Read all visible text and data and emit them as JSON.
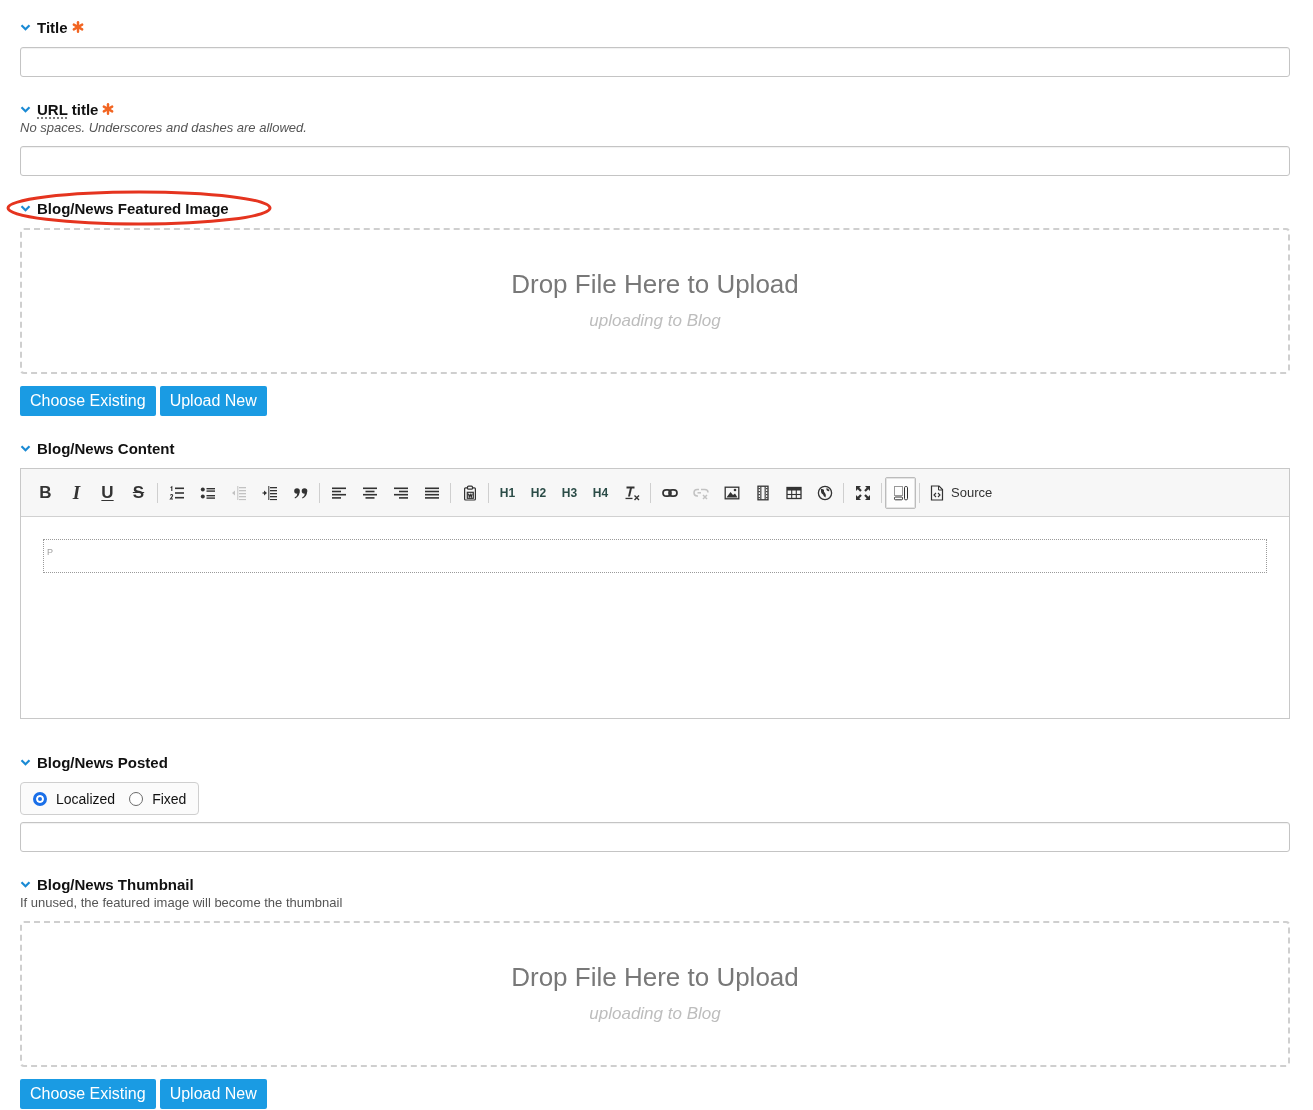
{
  "fields": [
    {
      "kind": "text",
      "label": "Title",
      "required": true,
      "expanded": true,
      "circled": false
    },
    {
      "kind": "text",
      "abbr": "URL",
      "label": "title",
      "required": true,
      "expanded": true,
      "circled": false,
      "hint": "No spaces. Underscores and dashes are allowed.",
      "hint_italic": true
    },
    {
      "kind": "file",
      "label": "Blog/News Featured Image",
      "required": false,
      "expanded": true,
      "circled": true,
      "dropzone": {
        "title": "Drop File Here to Upload",
        "subtitle": "uploading to Blog"
      },
      "buttons": [
        "Choose Existing",
        "Upload New"
      ]
    },
    {
      "kind": "editor",
      "label": "Blog/News Content",
      "required": false,
      "expanded": true,
      "circled": false,
      "toolbar": [
        [
          {
            "kind": "bold",
            "label": "B",
            "disabled": false,
            "on": false
          },
          {
            "kind": "italic",
            "label": "I",
            "disabled": false,
            "on": false
          },
          {
            "kind": "underline",
            "label": "U",
            "disabled": false,
            "on": false
          },
          {
            "kind": "strike",
            "label": "S",
            "disabled": false,
            "on": false
          }
        ],
        [
          {
            "kind": "ordered",
            "disabled": false,
            "on": false
          },
          {
            "kind": "bullets",
            "disabled": false,
            "on": false
          },
          {
            "kind": "outdent",
            "disabled": true,
            "on": false
          },
          {
            "kind": "indent",
            "disabled": false,
            "on": false
          },
          {
            "kind": "quote",
            "disabled": false,
            "on": false
          }
        ],
        [
          {
            "kind": "alignleft",
            "disabled": false,
            "on": false
          },
          {
            "kind": "aligncenter",
            "disabled": false,
            "on": false
          },
          {
            "kind": "alignright",
            "disabled": false,
            "on": false
          },
          {
            "kind": "justify",
            "disabled": false,
            "on": false
          }
        ],
        [
          {
            "kind": "pasteword",
            "disabled": false,
            "on": false
          }
        ],
        [
          {
            "kind": "heading",
            "label": "H1",
            "disabled": false,
            "on": false
          },
          {
            "kind": "heading",
            "label": "H2",
            "disabled": false,
            "on": false
          },
          {
            "kind": "heading",
            "label": "H3",
            "disabled": false,
            "on": false
          },
          {
            "kind": "heading",
            "label": "H4",
            "disabled": false,
            "on": false
          },
          {
            "kind": "clearformat",
            "disabled": false,
            "on": false
          }
        ],
        [
          {
            "kind": "link",
            "disabled": false,
            "on": false
          },
          {
            "kind": "unlink",
            "disabled": true,
            "on": false
          },
          {
            "kind": "image",
            "disabled": false,
            "on": false
          },
          {
            "kind": "video",
            "disabled": false,
            "on": false
          },
          {
            "kind": "table",
            "disabled": false,
            "on": false
          },
          {
            "kind": "globe",
            "disabled": false,
            "on": false
          }
        ],
        [
          {
            "kind": "maximize",
            "disabled": false,
            "on": false
          }
        ],
        [
          {
            "kind": "showblocks",
            "disabled": false,
            "on": true
          }
        ],
        [
          {
            "kind": "source",
            "label": "Source",
            "disabled": false,
            "on": false
          }
        ]
      ],
      "blocks": [
        {
          "tag": "P"
        }
      ]
    },
    {
      "kind": "date",
      "label": "Blog/News Posted",
      "required": false,
      "expanded": true,
      "circled": false,
      "modes": [
        {
          "label": "Localized",
          "selected": true
        },
        {
          "label": "Fixed",
          "selected": false
        }
      ]
    },
    {
      "kind": "file",
      "label": "Blog/News Thumbnail",
      "required": false,
      "expanded": true,
      "circled": false,
      "hint": "If unused, the featured image will become the thumbnail",
      "hint_italic": false,
      "dropzone": {
        "title": "Drop File Here to Upload",
        "subtitle": "uploading to Blog"
      },
      "buttons": [
        "Choose Existing",
        "Upload New"
      ]
    }
  ]
}
